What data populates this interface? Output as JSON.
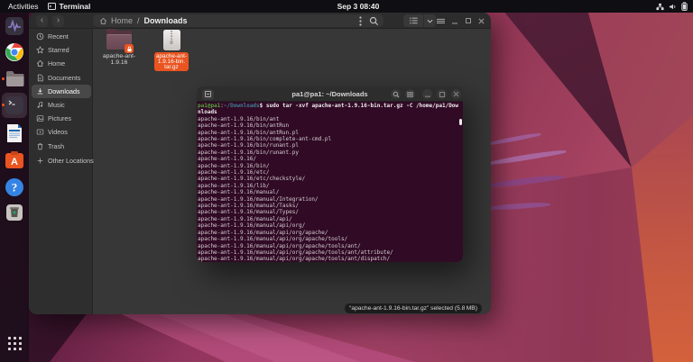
{
  "topbar": {
    "activities_label": "Activities",
    "focused_app_label": "Terminal",
    "clock": "Sep 3 08:40"
  },
  "dock": {
    "items": [
      {
        "icon": "system-monitor-icon",
        "running": false,
        "focused": false
      },
      {
        "icon": "chrome-icon",
        "running": false,
        "focused": false
      },
      {
        "icon": "files-icon",
        "running": true,
        "focused": false
      },
      {
        "icon": "terminal-icon",
        "running": true,
        "focused": true
      },
      {
        "icon": "libreoffice-writer-icon",
        "running": false,
        "focused": false
      },
      {
        "icon": "ubuntu-software-icon",
        "running": false,
        "focused": false
      },
      {
        "icon": "help-icon",
        "running": false,
        "focused": false
      },
      {
        "icon": "trash-icon",
        "running": false,
        "focused": false
      }
    ]
  },
  "files_window": {
    "breadcrumb": {
      "home": "Home",
      "separator": "/",
      "current": "Downloads"
    },
    "nav": {
      "back_glyph": "‹",
      "forward_glyph": "›"
    },
    "sidebar": [
      {
        "label": "Recent"
      },
      {
        "label": "Starred"
      },
      {
        "label": "Home"
      },
      {
        "label": "Documents"
      },
      {
        "label": "Downloads",
        "selected": true
      },
      {
        "label": "Music"
      },
      {
        "label": "Pictures"
      },
      {
        "label": "Videos"
      },
      {
        "label": "Trash"
      },
      {
        "label": "Other Locations"
      }
    ],
    "files": [
      {
        "type": "folder",
        "label_line1": "apache-ant-",
        "label_line2": "1.9.16",
        "selected": false
      },
      {
        "type": "archive",
        "label_line1": "apache-ant-",
        "label_line2": "1.9.16-bin.",
        "label_line3": "tar.gz",
        "selected": true
      }
    ],
    "status_text": "“apache-ant-1.9.16-bin.tar.gz” selected (5.8 MB)"
  },
  "terminal": {
    "title": "pa1@pa1: ~/Downloads",
    "prompt_user": "pa1@pa1",
    "prompt_colon": ":",
    "prompt_path": "~/Downloads",
    "prompt_symbol": "$ ",
    "command_line_1": "sudo tar -xvf apache-ant-1.9.16-bin.tar.gz -C /home/pa1/Dow",
    "command_line_2_wrap": "nloads",
    "output_lines": [
      "apache-ant-1.9.16/bin/ant",
      "apache-ant-1.9.16/bin/antRun",
      "apache-ant-1.9.16/bin/antRun.pl",
      "apache-ant-1.9.16/bin/complete-ant-cmd.pl",
      "apache-ant-1.9.16/bin/runant.pl",
      "apache-ant-1.9.16/bin/runant.py",
      "apache-ant-1.9.16/",
      "apache-ant-1.9.16/bin/",
      "apache-ant-1.9.16/etc/",
      "apache-ant-1.9.16/etc/checkstyle/",
      "apache-ant-1.9.16/lib/",
      "apache-ant-1.9.16/manual/",
      "apache-ant-1.9.16/manual/Integration/",
      "apache-ant-1.9.16/manual/Tasks/",
      "apache-ant-1.9.16/manual/Types/",
      "apache-ant-1.9.16/manual/api/",
      "apache-ant-1.9.16/manual/api/org/",
      "apache-ant-1.9.16/manual/api/org/apache/",
      "apache-ant-1.9.16/manual/api/org/apache/tools/",
      "apache-ant-1.9.16/manual/api/org/apache/tools/ant/",
      "apache-ant-1.9.16/manual/api/org/apache/tools/ant/attribute/",
      "apache-ant-1.9.16/manual/api/org/apache/tools/ant/dispatch/"
    ]
  },
  "colors": {
    "accent_orange": "#e95420",
    "terminal_background": "#310b25",
    "prompt_user_green": "#55a33b",
    "prompt_path_blue": "#3e7f96"
  }
}
